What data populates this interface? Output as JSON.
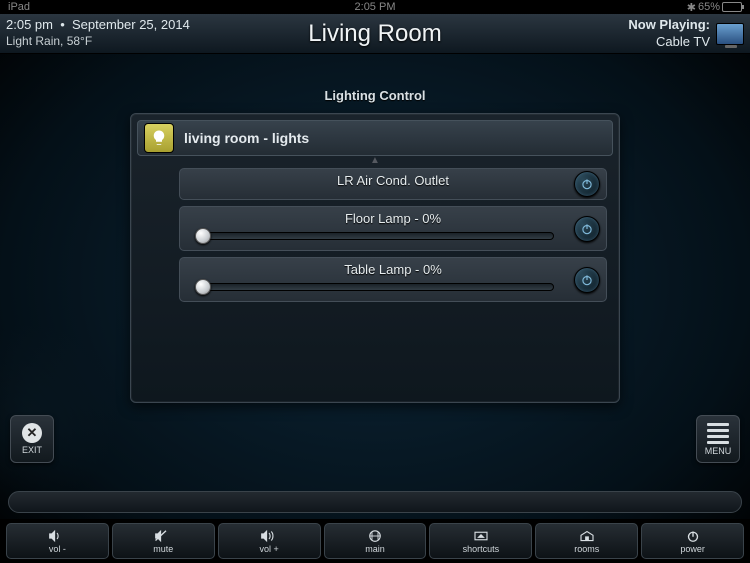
{
  "ipad_status": {
    "device": "iPad",
    "time": "2:05 PM",
    "battery_percent": "65%"
  },
  "header": {
    "time": "2:05 pm",
    "date": "September 25, 2014",
    "weather": "Light Rain, 58°F",
    "title": "Living Room",
    "now_playing_label": "Now Playing:",
    "now_playing_value": "Cable TV"
  },
  "section_title": "Lighting Control",
  "zone": {
    "label": "living room - lights",
    "icon": "bulb-icon"
  },
  "devices": [
    {
      "name": "LR Air Cond. Outlet",
      "has_slider": false
    },
    {
      "name": "Floor Lamp - 0%",
      "has_slider": true,
      "level": 0
    },
    {
      "name": "Table Lamp - 0%",
      "has_slider": true,
      "level": 0
    }
  ],
  "side_buttons": {
    "exit": "EXIT",
    "menu": "MENU"
  },
  "toolbar": [
    {
      "id": "vol-down",
      "label": "vol -",
      "icon": "speaker"
    },
    {
      "id": "mute",
      "label": "mute",
      "icon": "speaker-mute"
    },
    {
      "id": "vol-up",
      "label": "vol +",
      "icon": "speaker"
    },
    {
      "id": "main",
      "label": "main",
      "icon": "grid"
    },
    {
      "id": "shortcuts",
      "label": "shortcuts",
      "icon": "up-panel"
    },
    {
      "id": "rooms",
      "label": "rooms",
      "icon": "house"
    },
    {
      "id": "power",
      "label": "power",
      "icon": "power"
    }
  ]
}
